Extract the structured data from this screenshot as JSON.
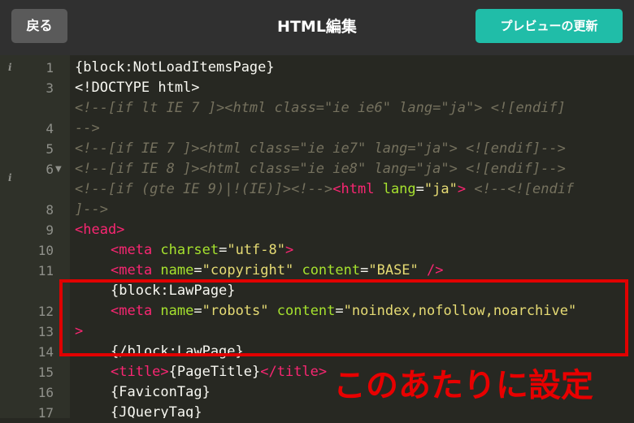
{
  "header": {
    "back_label": "戻る",
    "title": "HTML編集",
    "update_label": "プレビューの更新"
  },
  "gutter": {
    "line_numbers": [
      "1",
      "3",
      "",
      "4",
      "5",
      "6",
      "",
      "8",
      "9",
      "10",
      "11",
      "",
      "12",
      "13",
      "14",
      "15",
      "16",
      "17"
    ]
  },
  "code": {
    "l1": "{block:NotLoadItemsPage}",
    "l2": "<!DOCTYPE html>",
    "l3": "<!--[if lt IE 7 ]><html class=\"ie ie6\" lang=\"ja\"> <![endif]",
    "l4": "-->",
    "l5": "<!--[if IE 7 ]><html class=\"ie ie7\" lang=\"ja\"> <![endif]-->",
    "l6": "<!--[if IE 8 ]><html class=\"ie ie8\" lang=\"ja\"> <![endif]-->",
    "l7_comment": "<!--[if (gte IE 9)|!(IE)]><!-->",
    "l7_tag_open": "<html",
    "l7_attr": " lang",
    "l7_eq": "=",
    "l7_str": "\"ja\"",
    "l7_tag_close": ">",
    "l7_tail": " <!--<![endif",
    "l8": "]-->",
    "l9": "<head>",
    "l10_tag": "<meta",
    "l10_attr": " charset",
    "l10_eq": "=",
    "l10_str": "\"utf-8\"",
    "l10_close": ">",
    "l11_tag": "<meta",
    "l11_attr1": " name",
    "l11_eq1": "=",
    "l11_str1": "\"copyright\"",
    "l11_attr2": " content",
    "l11_eq2": "=",
    "l11_str2": "\"BASE\"",
    "l11_close": " />",
    "l12": "{block:LawPage}",
    "l13_tag": "<meta",
    "l13_attr1": " name",
    "l13_eq1": "=",
    "l13_str1": "\"robots\"",
    "l13_attr2": " content",
    "l13_eq2": "=",
    "l13_str2": "\"noindex,nofollow,noarchive\"",
    "l14": ">",
    "l15": "{/block:LawPage}",
    "l16_open": "<title>",
    "l16_text": "{PageTitle}",
    "l16_close": "</title>",
    "l17": "{FaviconTag}",
    "l18": "{JQueryTag}"
  },
  "annotation": {
    "text": "このあたりに設定",
    "color": "#e80000"
  },
  "colors": {
    "editor_bg": "#272822",
    "accent": "#20bda8",
    "tag": "#f92672",
    "attr": "#a6e22e",
    "string": "#e6db74",
    "comment": "#75715e"
  },
  "icons": {
    "info": "info-icon",
    "fold": "fold-arrow-icon"
  }
}
